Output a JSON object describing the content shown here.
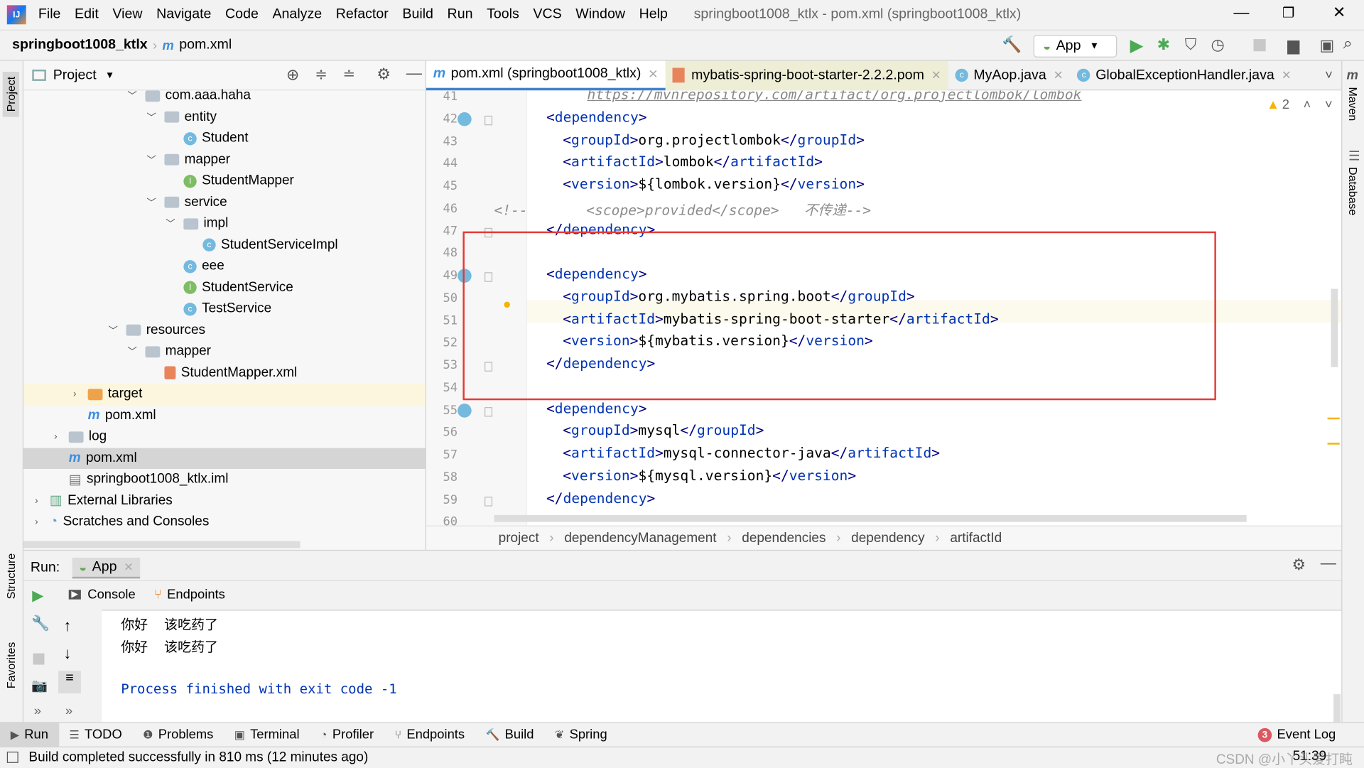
{
  "window": {
    "title": "springboot1008_ktlx - pom.xml (springboot1008_ktlx)"
  },
  "menu": [
    "File",
    "Edit",
    "View",
    "Navigate",
    "Code",
    "Analyze",
    "Refactor",
    "Build",
    "Run",
    "Tools",
    "VCS",
    "Window",
    "Help"
  ],
  "nav": {
    "project": "springboot1008_ktlx",
    "file": "pom.xml",
    "run_config": "App"
  },
  "left_stripe": {
    "project": "Project",
    "structure": "Structure",
    "favorites": "Favorites"
  },
  "right_stripe": {
    "maven": "Maven",
    "database": "Database"
  },
  "project_panel": {
    "title": "Project",
    "tree": [
      {
        "label": "com.aaa.haha",
        "depth": 5,
        "icon": "package",
        "expanded": true
      },
      {
        "label": "entity",
        "depth": 6,
        "icon": "package",
        "expanded": true
      },
      {
        "label": "Student",
        "depth": 7,
        "icon": "class"
      },
      {
        "label": "mapper",
        "depth": 6,
        "icon": "package",
        "expanded": true
      },
      {
        "label": "StudentMapper",
        "depth": 7,
        "icon": "interface"
      },
      {
        "label": "service",
        "depth": 6,
        "icon": "package",
        "expanded": true
      },
      {
        "label": "impl",
        "depth": 7,
        "icon": "package",
        "expanded": true
      },
      {
        "label": "StudentServiceImpl",
        "depth": 8,
        "icon": "class"
      },
      {
        "label": "eee",
        "depth": 7,
        "icon": "class"
      },
      {
        "label": "StudentService",
        "depth": 7,
        "icon": "interface"
      },
      {
        "label": "TestService",
        "depth": 7,
        "icon": "class"
      },
      {
        "label": "resources",
        "depth": 4,
        "icon": "resources",
        "expanded": true
      },
      {
        "label": "mapper",
        "depth": 5,
        "icon": "folder",
        "expanded": true
      },
      {
        "label": "StudentMapper.xml",
        "depth": 6,
        "icon": "xml"
      },
      {
        "label": "target",
        "depth": 2,
        "icon": "folder-orange",
        "expanded": false
      },
      {
        "label": "pom.xml",
        "depth": 2,
        "icon": "maven"
      },
      {
        "label": "log",
        "depth": 1,
        "icon": "folder",
        "expanded": false
      },
      {
        "label": "pom.xml",
        "depth": 1,
        "icon": "maven",
        "selected": true
      },
      {
        "label": "springboot1008_ktlx.iml",
        "depth": 1,
        "icon": "iml"
      },
      {
        "label": "External Libraries",
        "depth": 0,
        "icon": "libraries",
        "expanded": false
      },
      {
        "label": "Scratches and Consoles",
        "depth": 0,
        "icon": "scratches",
        "expanded": false
      }
    ]
  },
  "tabs": [
    {
      "label": "pom.xml (springboot1008_ktlx)",
      "icon": "maven",
      "active": true
    },
    {
      "label": "mybatis-spring-boot-starter-2.2.2.pom",
      "icon": "xml"
    },
    {
      "label": "MyAop.java",
      "icon": "class"
    },
    {
      "label": "GlobalExceptionHandler.java",
      "icon": "class"
    }
  ],
  "editor": {
    "warnings": "2",
    "lines": [
      {
        "n": "41",
        "text": "https://mvnrepository.com/artifact/org.projectlombok/lombok"
      },
      {
        "n": "42",
        "text": "<dependency>"
      },
      {
        "n": "43",
        "text": "<groupId>org.projectlombok</groupId>"
      },
      {
        "n": "44",
        "text": "<artifactId>lombok</artifactId>"
      },
      {
        "n": "45",
        "text": "<version>${lombok.version}</version>"
      },
      {
        "n": "46",
        "text": "<!--       <scope>provided</scope>   不传递-->"
      },
      {
        "n": "47",
        "text": "</dependency>"
      },
      {
        "n": "48",
        "text": ""
      },
      {
        "n": "49",
        "text": "<dependency>"
      },
      {
        "n": "50",
        "text": "<groupId>org.mybatis.spring.boot</groupId>"
      },
      {
        "n": "51",
        "text": "<artifactId>mybatis-spring-boot-starter</artifactId>"
      },
      {
        "n": "52",
        "text": "<version>${mybatis.version}</version>"
      },
      {
        "n": "53",
        "text": "</dependency>"
      },
      {
        "n": "54",
        "text": ""
      },
      {
        "n": "55",
        "text": "<dependency>"
      },
      {
        "n": "56",
        "text": "<groupId>mysql</groupId>"
      },
      {
        "n": "57",
        "text": "<artifactId>mysql-connector-java</artifactId>"
      },
      {
        "n": "58",
        "text": "<version>${mysql.version}</version>"
      },
      {
        "n": "59",
        "text": "</dependency>"
      },
      {
        "n": "60",
        "text": ""
      }
    ],
    "highlight_color": "#e53935"
  },
  "breadcrumbs": [
    "project",
    "dependencyManagement",
    "dependencies",
    "dependency",
    "artifactId"
  ],
  "run_panel": {
    "label": "Run:",
    "config": "App",
    "tabs": [
      "Console",
      "Endpoints"
    ],
    "output": [
      "你好  该吃药了",
      "你好  该吃药了",
      "",
      "Process finished with exit code -1"
    ]
  },
  "tool_windows": [
    "Run",
    "TODO",
    "Problems",
    "Terminal",
    "Profiler",
    "Endpoints",
    "Build",
    "Spring"
  ],
  "event_log": {
    "label": "Event Log",
    "count": "3"
  },
  "status": {
    "message": "Build completed successfully in 810 ms (12 minutes ago)",
    "position": "51:39",
    "watermark": "CSDN @小丫头爱打盹"
  }
}
